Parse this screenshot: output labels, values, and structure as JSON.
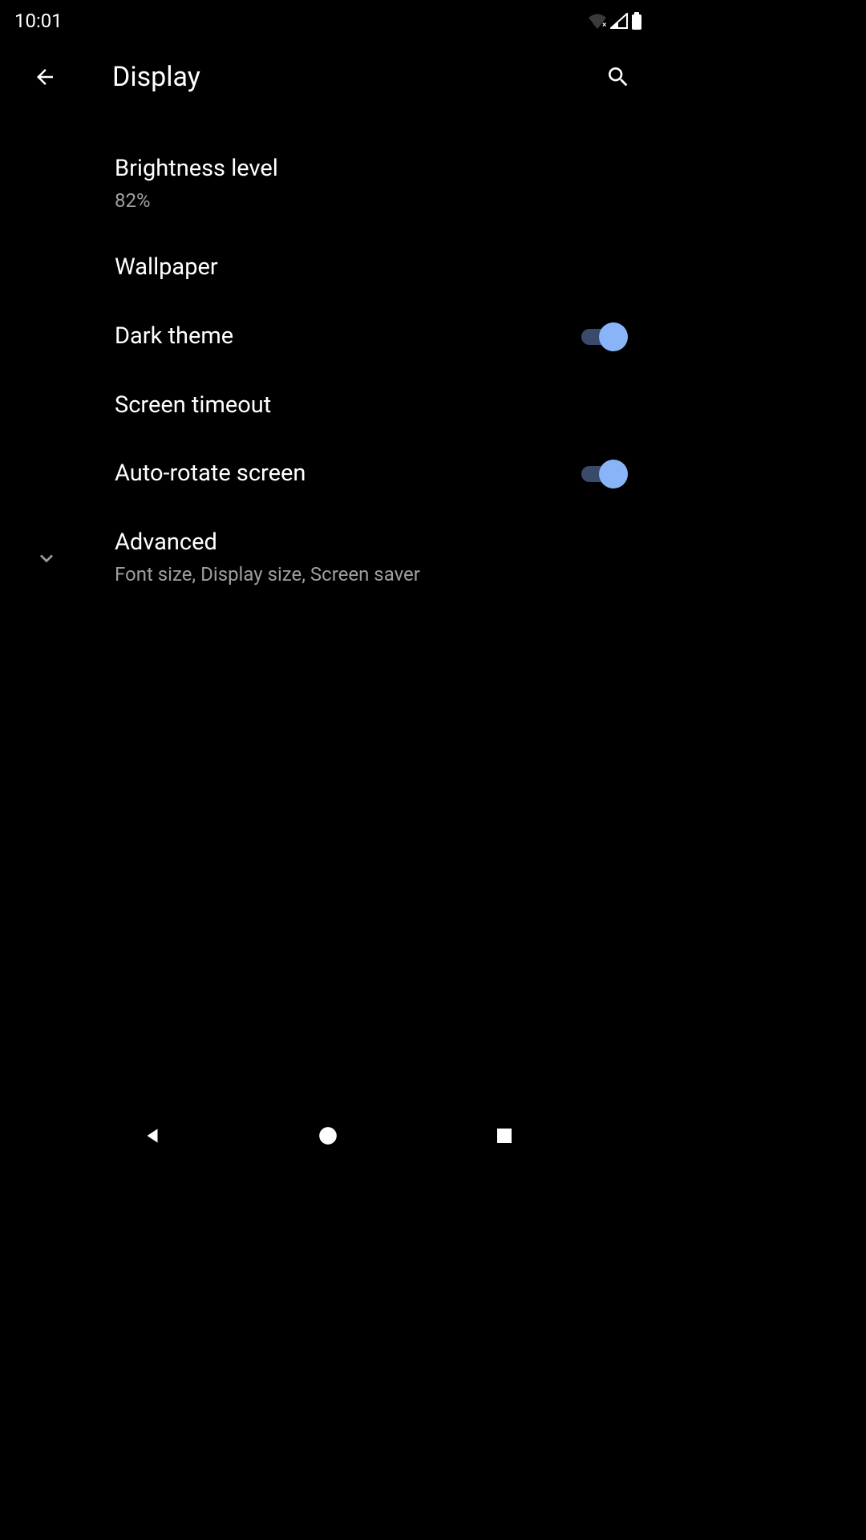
{
  "statusBar": {
    "time": "10:01"
  },
  "appBar": {
    "title": "Display"
  },
  "settings": {
    "brightness": {
      "title": "Brightness level",
      "value": "82%"
    },
    "wallpaper": {
      "title": "Wallpaper"
    },
    "darkTheme": {
      "title": "Dark theme",
      "enabled": true
    },
    "screenTimeout": {
      "title": "Screen timeout"
    },
    "autoRotate": {
      "title": "Auto-rotate screen",
      "enabled": true
    },
    "advanced": {
      "title": "Advanced",
      "subtitle": "Font size, Display size, Screen saver"
    }
  }
}
